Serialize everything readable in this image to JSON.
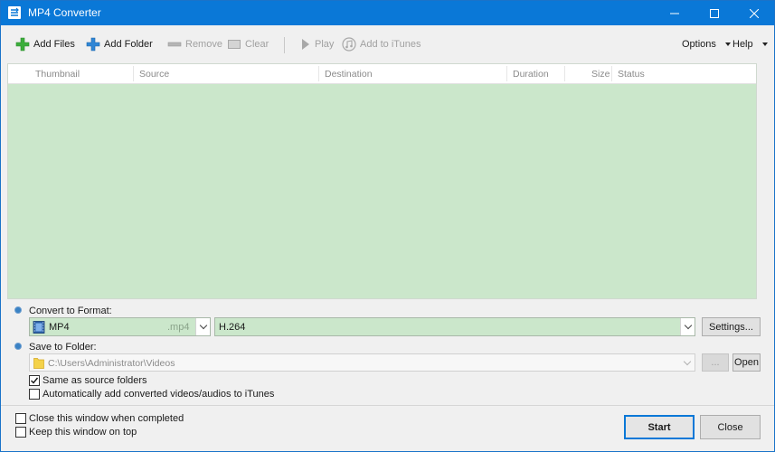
{
  "window": {
    "title": "MP4 Converter"
  },
  "toolbar": {
    "add_files": "Add Files",
    "add_folder": "Add Folder",
    "remove": "Remove",
    "clear": "Clear",
    "play": "Play",
    "add_to_itunes": "Add to iTunes",
    "options": "Options",
    "help": "Help"
  },
  "table": {
    "columns": [
      "Thumbnail",
      "Source",
      "Destination",
      "Duration",
      "Size",
      "Status"
    ],
    "rows": []
  },
  "convert": {
    "label": "Convert to Format:",
    "format_name": "MP4",
    "format_ext": ".mp4",
    "codec": "H.264",
    "settings_button": "Settings..."
  },
  "save": {
    "label": "Save to Folder:",
    "path": "C:\\Users\\Administrator\\Videos",
    "browse_button": "...",
    "open_button": "Open",
    "same_as_source": {
      "label": "Same as source folders",
      "checked": true
    },
    "add_to_itunes": {
      "label": "Automatically add converted videos/audios to iTunes",
      "checked": false
    }
  },
  "footer": {
    "close_when_completed": {
      "label": "Close this window when completed",
      "checked": false
    },
    "keep_on_top": {
      "label": "Keep this window on top",
      "checked": false
    },
    "start_button": "Start",
    "close_button": "Close"
  },
  "colors": {
    "title_bar": "#0a78d7",
    "list_background": "#cbe7cb",
    "add_icon": "#3cae3c",
    "folder_icon": "#2f86d6"
  }
}
